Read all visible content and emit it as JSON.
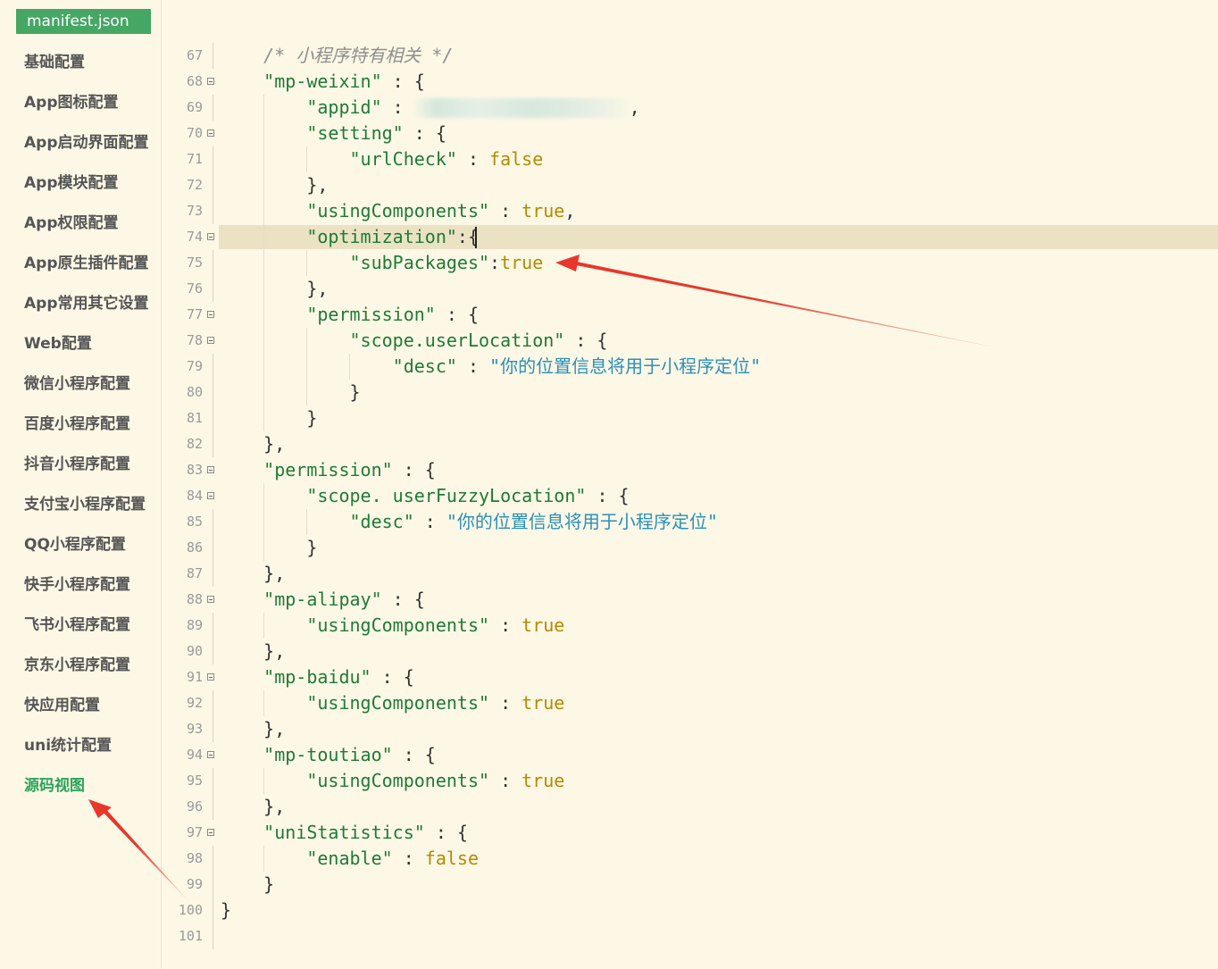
{
  "tab": {
    "title": "manifest.json"
  },
  "sidebar": {
    "items": [
      {
        "label": "基础配置",
        "name": "sidebar-item-basic",
        "active": false
      },
      {
        "label": "App图标配置",
        "name": "sidebar-item-app-icon",
        "active": false
      },
      {
        "label": "App启动界面配置",
        "name": "sidebar-item-app-splash",
        "active": false
      },
      {
        "label": "App模块配置",
        "name": "sidebar-item-app-modules",
        "active": false
      },
      {
        "label": "App权限配置",
        "name": "sidebar-item-app-permissions",
        "active": false
      },
      {
        "label": "App原生插件配置",
        "name": "sidebar-item-app-native-plugins",
        "active": false
      },
      {
        "label": "App常用其它设置",
        "name": "sidebar-item-app-other",
        "active": false
      },
      {
        "label": "Web配置",
        "name": "sidebar-item-web",
        "active": false
      },
      {
        "label": "微信小程序配置",
        "name": "sidebar-item-mp-weixin",
        "active": false
      },
      {
        "label": "百度小程序配置",
        "name": "sidebar-item-mp-baidu",
        "active": false
      },
      {
        "label": "抖音小程序配置",
        "name": "sidebar-item-mp-douyin",
        "active": false
      },
      {
        "label": "支付宝小程序配置",
        "name": "sidebar-item-mp-alipay",
        "active": false
      },
      {
        "label": "QQ小程序配置",
        "name": "sidebar-item-mp-qq",
        "active": false
      },
      {
        "label": "快手小程序配置",
        "name": "sidebar-item-mp-kuaishou",
        "active": false
      },
      {
        "label": "飞书小程序配置",
        "name": "sidebar-item-mp-feishu",
        "active": false
      },
      {
        "label": "京东小程序配置",
        "name": "sidebar-item-mp-jd",
        "active": false
      },
      {
        "label": "快应用配置",
        "name": "sidebar-item-quickapp",
        "active": false
      },
      {
        "label": "uni统计配置",
        "name": "sidebar-item-uni-statistics",
        "active": false
      },
      {
        "label": "源码视图",
        "name": "sidebar-item-source-view",
        "active": true
      }
    ]
  },
  "editor": {
    "current_line": 74,
    "lines": [
      {
        "n": "67",
        "fold": false,
        "tokens": [
          [
            "c",
            "    /* 小程序特有相关 */"
          ]
        ]
      },
      {
        "n": "68",
        "fold": true,
        "tokens": [
          [
            "k",
            "    \"mp-weixin\""
          ],
          [
            "p",
            " : {"
          ]
        ]
      },
      {
        "n": "69",
        "fold": false,
        "tokens": [
          [
            "k",
            "        \"appid\""
          ],
          [
            "p",
            " : "
          ],
          [
            "p",
            "                    ,"
          ]
        ]
      },
      {
        "n": "70",
        "fold": true,
        "tokens": [
          [
            "k",
            "        \"setting\""
          ],
          [
            "p",
            " : {"
          ]
        ]
      },
      {
        "n": "71",
        "fold": false,
        "tokens": [
          [
            "k",
            "            \"urlCheck\""
          ],
          [
            "p",
            " : "
          ],
          [
            "b",
            "false"
          ]
        ]
      },
      {
        "n": "72",
        "fold": false,
        "tokens": [
          [
            "p",
            "        },"
          ]
        ]
      },
      {
        "n": "73",
        "fold": false,
        "tokens": [
          [
            "k",
            "        \"usingComponents\""
          ],
          [
            "p",
            " : "
          ],
          [
            "b",
            "true"
          ],
          [
            "p",
            ","
          ]
        ]
      },
      {
        "n": "74",
        "fold": true,
        "tokens": [
          [
            "k",
            "        \"optimization\""
          ],
          [
            "p",
            ":{"
          ]
        ]
      },
      {
        "n": "75",
        "fold": false,
        "tokens": [
          [
            "k",
            "            \"subPackages\""
          ],
          [
            "p",
            ":"
          ],
          [
            "b",
            "true"
          ]
        ]
      },
      {
        "n": "76",
        "fold": false,
        "tokens": [
          [
            "p",
            "        },"
          ]
        ]
      },
      {
        "n": "77",
        "fold": true,
        "tokens": [
          [
            "k",
            "        \"permission\""
          ],
          [
            "p",
            " : {"
          ]
        ]
      },
      {
        "n": "78",
        "fold": true,
        "tokens": [
          [
            "k",
            "            \"scope.userLocation\""
          ],
          [
            "p",
            " : {"
          ]
        ]
      },
      {
        "n": "79",
        "fold": false,
        "tokens": [
          [
            "k",
            "                \"desc\""
          ],
          [
            "p",
            " : "
          ],
          [
            "s",
            "\"你的位置信息将用于小程序定位\""
          ]
        ]
      },
      {
        "n": "80",
        "fold": false,
        "tokens": [
          [
            "p",
            "            }"
          ]
        ]
      },
      {
        "n": "81",
        "fold": false,
        "tokens": [
          [
            "p",
            "        }"
          ]
        ]
      },
      {
        "n": "82",
        "fold": false,
        "tokens": [
          [
            "p",
            "    },"
          ]
        ]
      },
      {
        "n": "83",
        "fold": true,
        "tokens": [
          [
            "k",
            "    \"permission\""
          ],
          [
            "p",
            " : {"
          ]
        ]
      },
      {
        "n": "84",
        "fold": true,
        "tokens": [
          [
            "k",
            "        \"scope. userFuzzyLocation\""
          ],
          [
            "p",
            " : {"
          ]
        ]
      },
      {
        "n": "85",
        "fold": false,
        "tokens": [
          [
            "k",
            "            \"desc\""
          ],
          [
            "p",
            " : "
          ],
          [
            "s",
            "\"你的位置信息将用于小程序定位\""
          ]
        ]
      },
      {
        "n": "86",
        "fold": false,
        "tokens": [
          [
            "p",
            "        }"
          ]
        ]
      },
      {
        "n": "87",
        "fold": false,
        "tokens": [
          [
            "p",
            "    },"
          ]
        ]
      },
      {
        "n": "88",
        "fold": true,
        "tokens": [
          [
            "k",
            "    \"mp-alipay\""
          ],
          [
            "p",
            " : {"
          ]
        ]
      },
      {
        "n": "89",
        "fold": false,
        "tokens": [
          [
            "k",
            "        \"usingComponents\""
          ],
          [
            "p",
            " : "
          ],
          [
            "b",
            "true"
          ]
        ]
      },
      {
        "n": "90",
        "fold": false,
        "tokens": [
          [
            "p",
            "    },"
          ]
        ]
      },
      {
        "n": "91",
        "fold": true,
        "tokens": [
          [
            "k",
            "    \"mp-baidu\""
          ],
          [
            "p",
            " : {"
          ]
        ]
      },
      {
        "n": "92",
        "fold": false,
        "tokens": [
          [
            "k",
            "        \"usingComponents\""
          ],
          [
            "p",
            " : "
          ],
          [
            "b",
            "true"
          ]
        ]
      },
      {
        "n": "93",
        "fold": false,
        "tokens": [
          [
            "p",
            "    },"
          ]
        ]
      },
      {
        "n": "94",
        "fold": true,
        "tokens": [
          [
            "k",
            "    \"mp-toutiao\""
          ],
          [
            "p",
            " : {"
          ]
        ]
      },
      {
        "n": "95",
        "fold": false,
        "tokens": [
          [
            "k",
            "        \"usingComponents\""
          ],
          [
            "p",
            " : "
          ],
          [
            "b",
            "true"
          ]
        ]
      },
      {
        "n": "96",
        "fold": false,
        "tokens": [
          [
            "p",
            "    },"
          ]
        ]
      },
      {
        "n": "97",
        "fold": true,
        "tokens": [
          [
            "k",
            "    \"uniStatistics\""
          ],
          [
            "p",
            " : {"
          ]
        ]
      },
      {
        "n": "98",
        "fold": false,
        "tokens": [
          [
            "k",
            "        \"enable\""
          ],
          [
            "p",
            " : "
          ],
          [
            "b",
            "false"
          ]
        ]
      },
      {
        "n": "99",
        "fold": false,
        "tokens": [
          [
            "p",
            "    }"
          ]
        ]
      },
      {
        "n": "100",
        "fold": false,
        "tokens": [
          [
            "p",
            "}"
          ]
        ]
      },
      {
        "n": "101",
        "fold": false,
        "tokens": []
      }
    ]
  },
  "colors": {
    "background": "#fdf8e6",
    "tab_background": "#46a764",
    "active_sidebar": "#2ba45a",
    "current_line": "#ebe2c4",
    "key": "#1f7a36",
    "boolean": "#b58900",
    "string": "#2a8fb8",
    "comment": "#8e8e8e",
    "annotation_arrow": "#e8372a"
  }
}
